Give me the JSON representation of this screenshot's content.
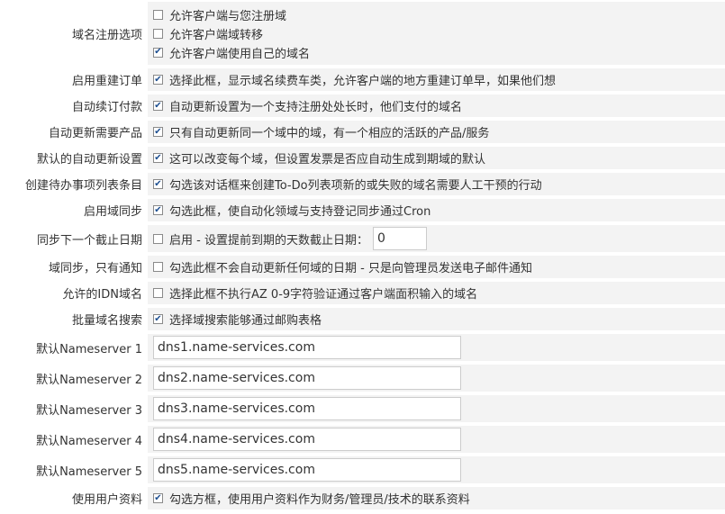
{
  "rows": {
    "registration": {
      "label": "域名注册选项",
      "opt1": {
        "checked": false,
        "text": "允许客户端与您注册域"
      },
      "opt2": {
        "checked": false,
        "text": "允许客户端域转移"
      },
      "opt3": {
        "checked": true,
        "text": "允许客户端使用自己的域名"
      }
    },
    "reorder": {
      "label": "启用重建订单",
      "checked": true,
      "text": "选择此框，显示域名续费车类，允许客户端的地方重建订单早，如果他们想"
    },
    "autorenew": {
      "label": "自动续订付款",
      "checked": true,
      "text": "自动更新设置为一个支持注册处处长时，他们支付的域名"
    },
    "needproduct": {
      "label": "自动更新需要产品",
      "checked": true,
      "text": "只有自动更新同一个域中的域，有一个相应的活跃的产品/服务"
    },
    "defaultrenew": {
      "label": "默认的自动更新设置",
      "checked": true,
      "text": "这可以改变每个域，但设置发票是否应自动生成到期域的默认"
    },
    "todo": {
      "label": "创建待办事项列表条目",
      "checked": true,
      "text": "勾选该对话框来创建To-Do列表项新的或失败的域名需要人工干预的行动"
    },
    "sync": {
      "label": "启用域同步",
      "checked": true,
      "text": "勾选此框，使自动化领域与支持登记同步通过Cron"
    },
    "cutoff": {
      "label": "同步下一个截止日期",
      "checked": false,
      "text": "启用 - 设置提前到期的天数截止日期：",
      "value": "0"
    },
    "notifyonly": {
      "label": "域同步，只有通知",
      "checked": false,
      "text": "勾选此框不会自动更新任何域的日期 - 只是向管理员发送电子邮件通知"
    },
    "idn": {
      "label": "允许的IDN域名",
      "checked": false,
      "text": "选择此框不执行AZ 0-9字符验证通过客户端面积输入的域名"
    },
    "bulk": {
      "label": "批量域名搜索",
      "checked": true,
      "text": "选择域搜索能够通过邮购表格"
    },
    "ns1": {
      "label": "默认Nameserver 1",
      "value": "dns1.name-services.com"
    },
    "ns2": {
      "label": "默认Nameserver 2",
      "value": "dns2.name-services.com"
    },
    "ns3": {
      "label": "默认Nameserver 3",
      "value": "dns3.name-services.com"
    },
    "ns4": {
      "label": "默认Nameserver 4",
      "value": "dns4.name-services.com"
    },
    "ns5": {
      "label": "默认Nameserver 5",
      "value": "dns5.name-services.com"
    },
    "userprofile": {
      "label": "使用用户资料",
      "checked": true,
      "text": "勾选方框，使用用户资料作为财务/管理员/技术的联系资料"
    }
  }
}
